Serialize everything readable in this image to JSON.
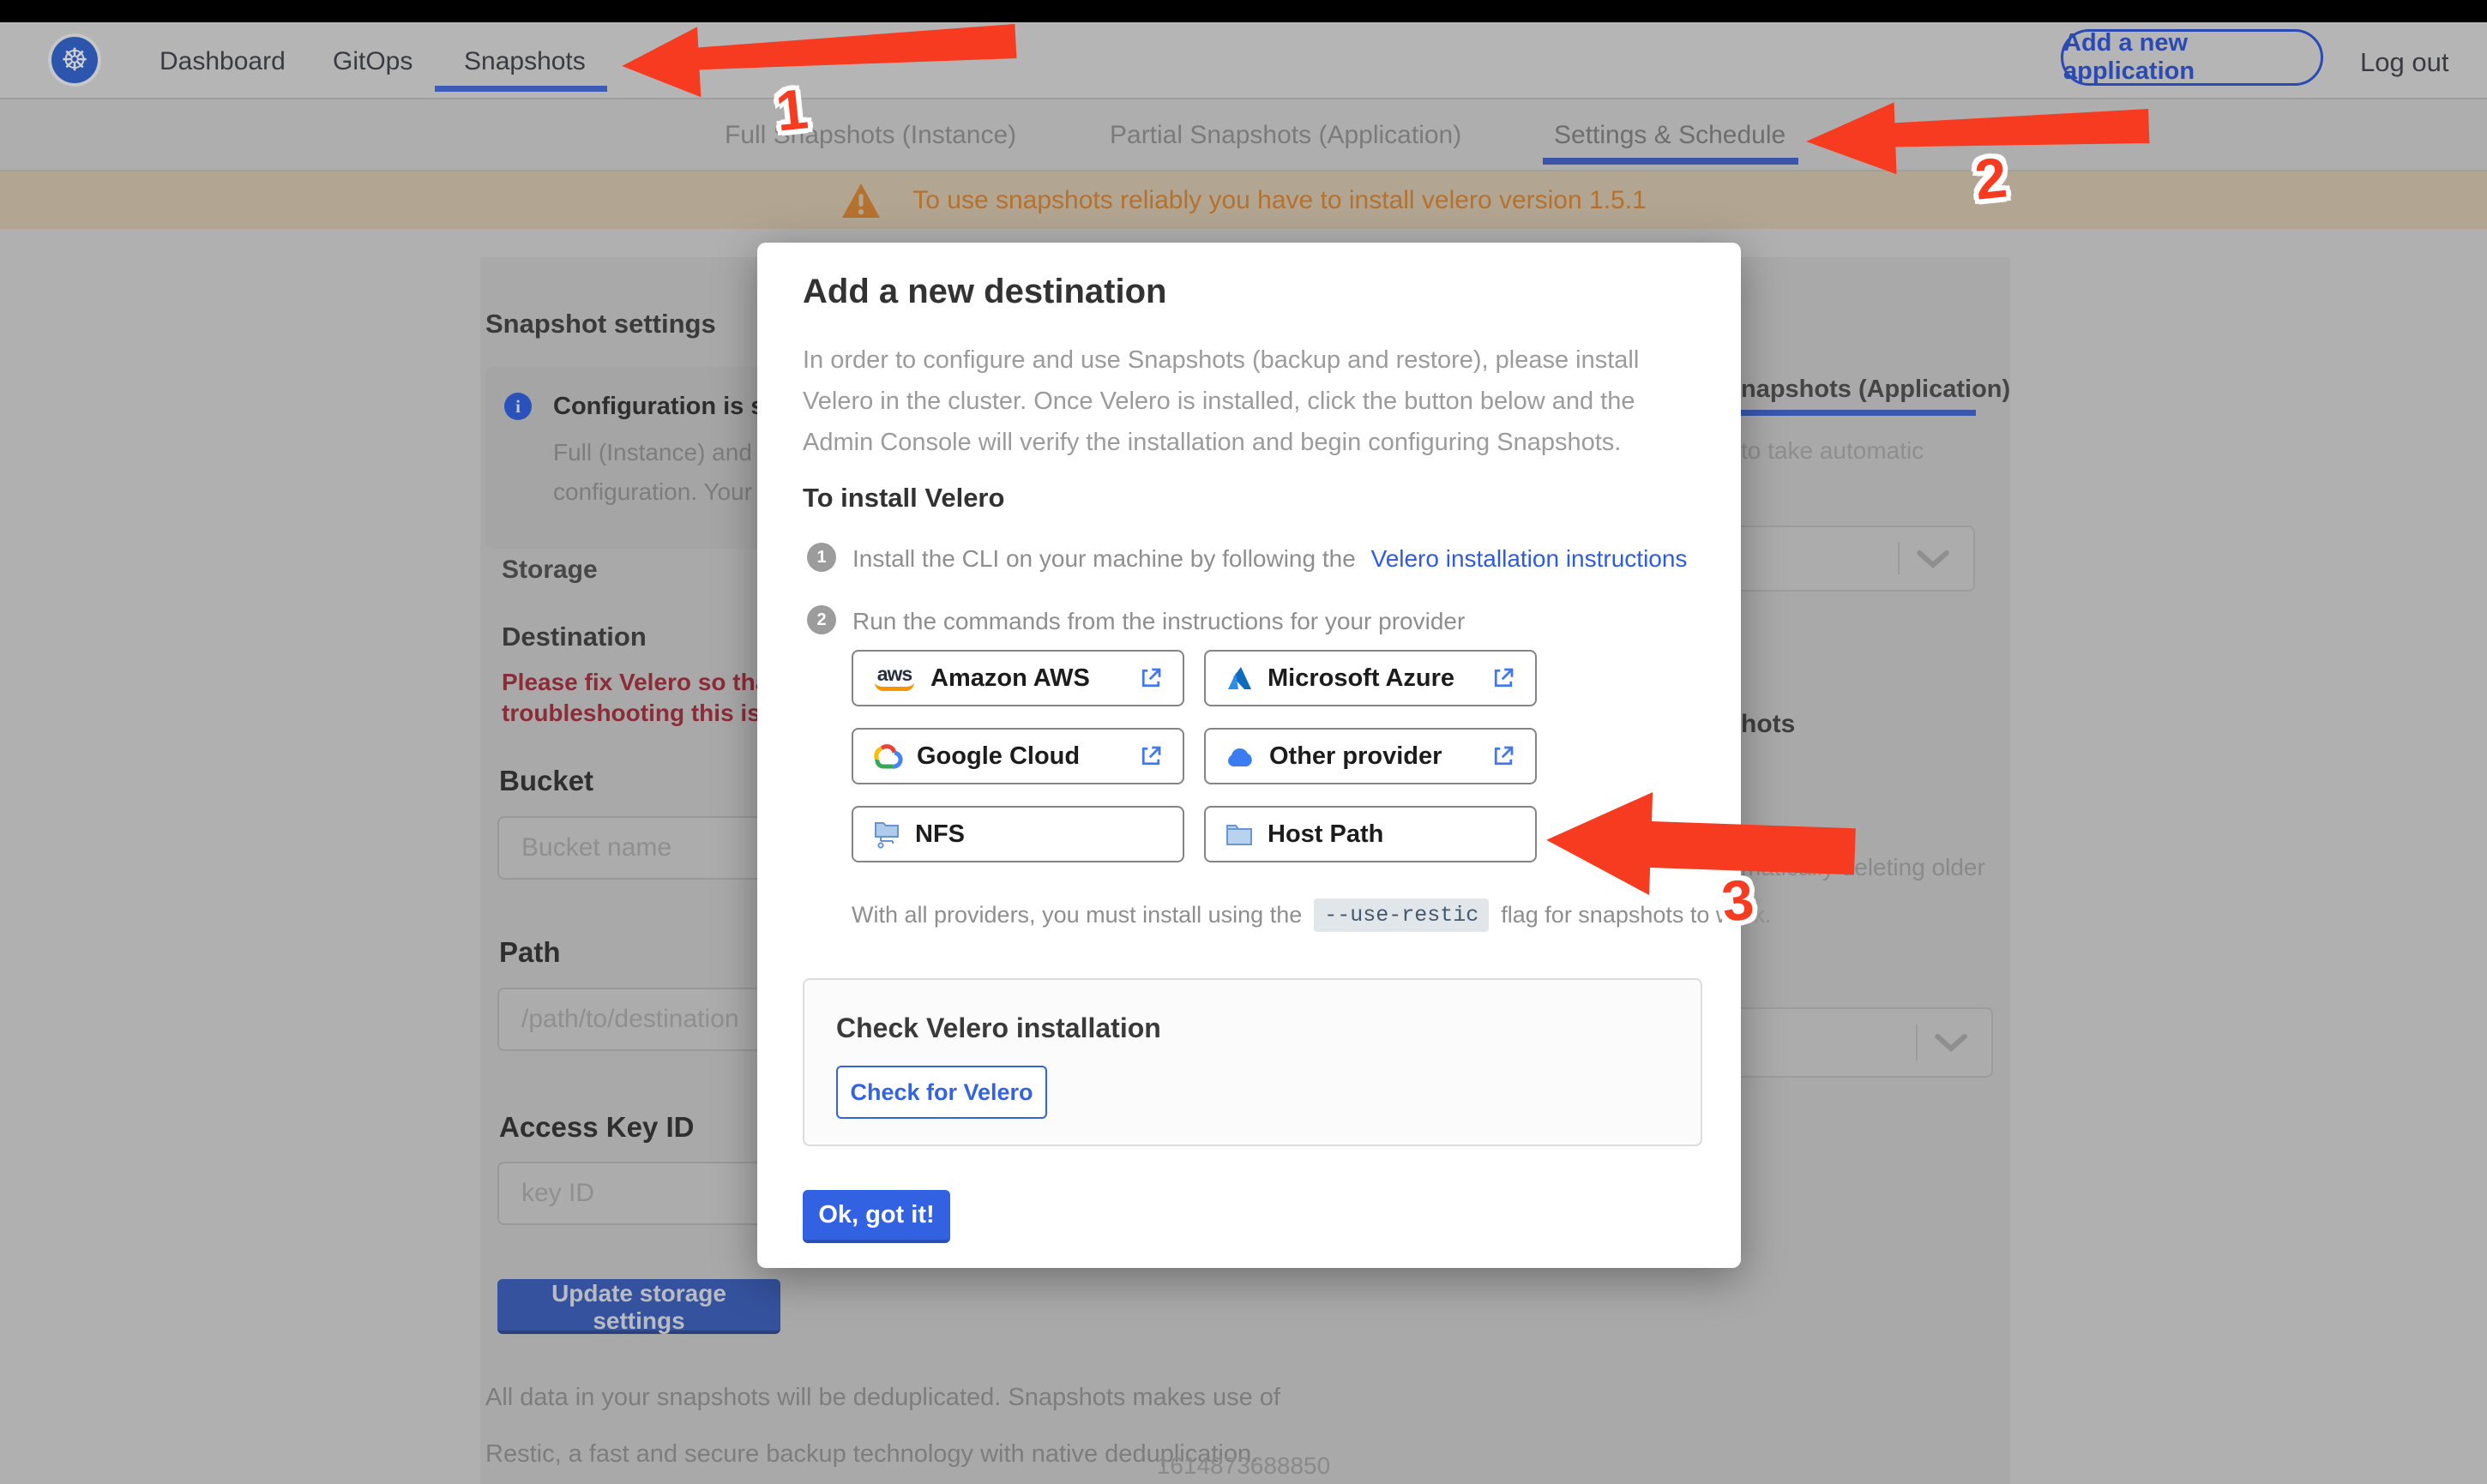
{
  "topnav": {
    "brand_icon": "kubernetes-logo",
    "brand_glyph": "☸",
    "items": [
      {
        "label": "Dashboard",
        "active": false
      },
      {
        "label": "GitOps",
        "active": false
      },
      {
        "label": "Snapshots",
        "active": true
      }
    ],
    "add_app_label": "Add a new application",
    "logout_label": "Log out"
  },
  "tabs": {
    "items": [
      "Full Snapshots (Instance)",
      "Partial Snapshots (Application)",
      "Settings & Schedule"
    ],
    "active": "Settings & Schedule"
  },
  "warning": {
    "text": "To use snapshots reliably you have to install velero version 1.5.1"
  },
  "settings_page": {
    "title": "Snapshot settings",
    "info_box": {
      "title": "Configuration is sh",
      "line1": "Full (Instance) and Parti",
      "line2": "configuration. Your stor"
    },
    "storage_heading": "Storage",
    "destination_heading": "Destination",
    "error_line1": "Please fix Velero so that th",
    "error_line2": "troubleshooting this issue",
    "bucket_label": "Bucket",
    "bucket_placeholder": "Bucket name",
    "path_label": "Path",
    "path_placeholder": "/path/to/destination",
    "access_key_label": "Access Key ID",
    "access_key_placeholder": "key ID",
    "update_button": "Update storage settings",
    "footer_line1": "All data in your snapshots will be deduplicated. Snapshots makes use of",
    "footer_line2": "Restic, a fast and secure backup technology with native deduplication.",
    "right_fragments": {
      "subtab": "napshots (Application)",
      "auto_text": "to take automatic",
      "heading_fragment": "hots",
      "older_text": "matically deleting older"
    }
  },
  "modal": {
    "title": "Add a new destination",
    "body_line1": "In order to configure and use Snapshots (backup and restore), please install",
    "body_line2": "Velero in the cluster. Once Velero is installed, click the button below and the",
    "body_line3": "Admin Console will verify the installation and begin configuring Snapshots.",
    "install_heading": "To install Velero",
    "step1_num": "1",
    "step1_text": "Install the CLI on your machine by following the",
    "step1_link": "Velero installation instructions",
    "step2_num": "2",
    "step2_text": "Run the commands from the instructions for your provider",
    "providers": [
      {
        "label": "Amazon AWS",
        "icon": "aws-logo",
        "external": true,
        "aws_word": "aws"
      },
      {
        "label": "Microsoft Azure",
        "icon": "azure-logo",
        "external": true
      },
      {
        "label": "Google Cloud",
        "icon": "gcp-logo",
        "external": true
      },
      {
        "label": "Other provider",
        "icon": "generic-cloud",
        "external": true
      },
      {
        "label": "NFS",
        "icon": "nfs-folder",
        "external": false
      },
      {
        "label": "Host Path",
        "icon": "hostpath-folder",
        "external": false
      }
    ],
    "restic_prefix": "With all providers, you must install using the",
    "restic_code": "--use-restic",
    "restic_suffix": "flag for snapshots to work.",
    "check_heading": "Check Velero installation",
    "check_button": "Check for Velero",
    "ok_button": "Ok, got it!"
  },
  "annotations": {
    "labels": [
      "1",
      "2",
      "3"
    ]
  },
  "footer_timestamp": "1614873688850",
  "colors": {
    "accent_blue": "#3262e1",
    "link_blue": "#2e5be0",
    "arrow_red": "#f63b21",
    "warning_orange": "#b5722e",
    "error_maroon": "#8b2d38",
    "k8s_blue": "#2c55ae"
  }
}
